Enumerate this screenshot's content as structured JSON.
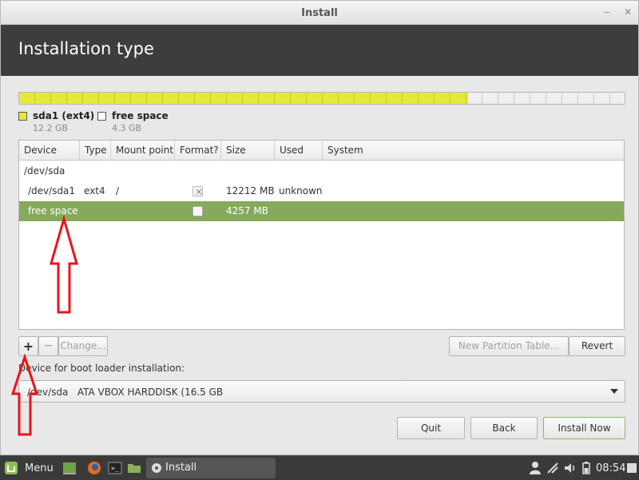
{
  "window": {
    "title": "Install"
  },
  "header": {
    "title": "Installation type"
  },
  "partition_bar": {
    "used_fraction": 0.741,
    "used_color": "#e6e93a",
    "free_color": "#f0f0f0"
  },
  "legend": [
    {
      "name": "sda1 (ext4)",
      "size": "12.2 GB",
      "color": "#e6e93a"
    },
    {
      "name": "free space",
      "size": "4.3 GB",
      "color": "#ffffff"
    }
  ],
  "table": {
    "columns": [
      "Device",
      "Type",
      "Mount point",
      "Format?",
      "Size",
      "Used",
      "System"
    ],
    "rows": [
      {
        "device": "/dev/sda",
        "type": "",
        "mount": "",
        "format": null,
        "size": "",
        "used": "",
        "system": ""
      },
      {
        "device": "/dev/sda1",
        "type": "ext4",
        "mount": "/",
        "format": "checked-disabled",
        "size": "12212 MB",
        "used": "unknown",
        "system": ""
      },
      {
        "device": "free space",
        "type": "",
        "mount": "",
        "format": "unchecked",
        "size": "4257 MB",
        "used": "",
        "system": "",
        "selected": true
      }
    ]
  },
  "toolbar": {
    "add_label": "+",
    "remove_label": "−",
    "change_label": "Change...",
    "new_partition_table_label": "New Partition Table...",
    "revert_label": "Revert"
  },
  "bootloader": {
    "label": "Device for boot loader installation:",
    "value": "/dev/sda   ATA VBOX HARDDISK (16.5 GB"
  },
  "buttons": {
    "quit": "Quit",
    "back": "Back",
    "install_now": "Install Now"
  },
  "taskbar": {
    "menu_label": "Menu",
    "window_label": "Install",
    "clock": "08:54"
  },
  "colors": {
    "accent_selected_row": "#86a95c",
    "annotation_arrow": "#e8141c",
    "header_bg": "#3d3d3d"
  }
}
